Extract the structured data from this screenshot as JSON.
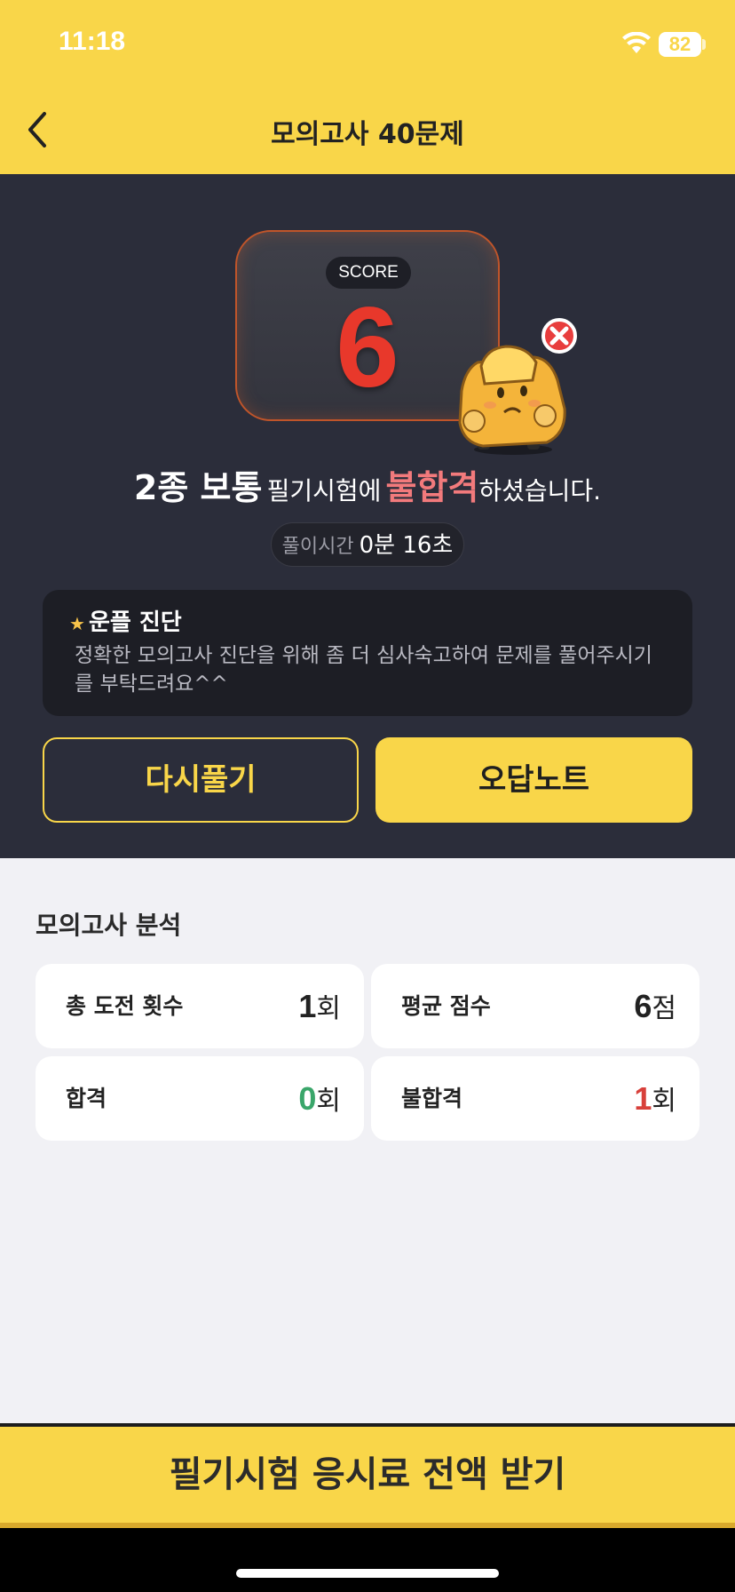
{
  "status_bar": {
    "time": "11:18",
    "battery": "82"
  },
  "header": {
    "title": "모의고사 40문제"
  },
  "result": {
    "score_label": "SCORE",
    "score_value": "6",
    "license_type": "2종 보통",
    "exam_word": "필기시험에",
    "fail_word": "불합격",
    "suffix": "하셨습니다.",
    "time_label": "풀이시간",
    "time_value": "0분 16초"
  },
  "diagnosis": {
    "title": "운플 진단",
    "text": "정확한 모의고사 진단을 위해 좀 더 심사숙고하여 문제를 풀어주시기를 부탁드려요^^"
  },
  "buttons": {
    "retry": "다시풀기",
    "wrong_note": "오답노트"
  },
  "analysis": {
    "title": "모의고사 분석",
    "stats": [
      {
        "label": "총 도전 횟수",
        "value": "1",
        "unit": "회"
      },
      {
        "label": "평균 점수",
        "value": "6",
        "unit": "점"
      },
      {
        "label": "합격",
        "value": "0",
        "unit": "회"
      },
      {
        "label": "불합격",
        "value": "1",
        "unit": "회"
      }
    ]
  },
  "cta": {
    "label": "필기시험 응시료 전액 받기"
  },
  "colors": {
    "accent": "#f9d649",
    "dark_bg": "#2b2d3a",
    "fail": "#e8382b",
    "pass": "#3aa66a"
  }
}
